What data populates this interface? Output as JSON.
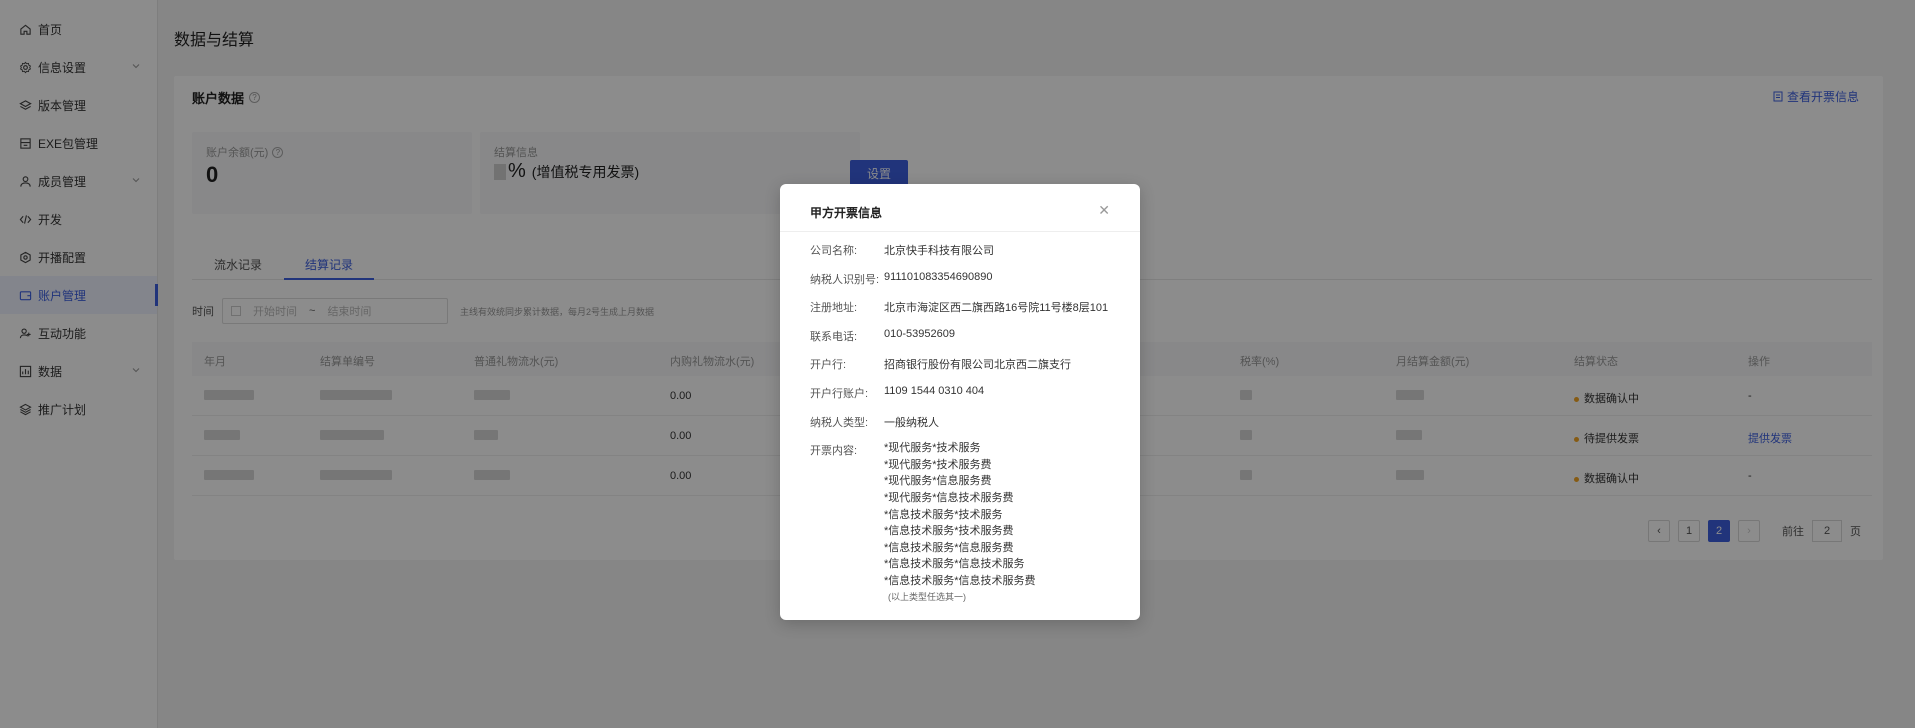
{
  "sidebar": {
    "items": [
      {
        "label": "首页",
        "icon": "home-icon",
        "has_children": false
      },
      {
        "label": "信息设置",
        "icon": "gear-icon",
        "has_children": true
      },
      {
        "label": "版本管理",
        "icon": "layers-icon",
        "has_children": false
      },
      {
        "label": "EXE包管理",
        "icon": "package-icon",
        "has_children": false
      },
      {
        "label": "成员管理",
        "icon": "user-icon",
        "has_children": true
      },
      {
        "label": "开发",
        "icon": "code-icon",
        "has_children": false
      },
      {
        "label": "开播配置",
        "icon": "settings-icon",
        "has_children": false
      },
      {
        "label": "账户管理",
        "icon": "wallet-icon",
        "has_children": false,
        "active": true
      },
      {
        "label": "互动功能",
        "icon": "user-plus-icon",
        "has_children": false
      },
      {
        "label": "数据",
        "icon": "chart-icon",
        "has_children": true
      },
      {
        "label": "推广计划",
        "icon": "stack-icon",
        "has_children": false
      }
    ]
  },
  "page": {
    "title": "数据与结算",
    "card_title": "账户数据",
    "invoice_link": "查看开票信息",
    "balance_label": "账户余额(元)",
    "balance_value": "0",
    "settlement_label": "结算信息",
    "settlement_pct": "%",
    "settlement_note": "(增值税专用发票)",
    "setting_button": "设置",
    "tabs": [
      "流水记录",
      "结算记录"
    ],
    "active_tab": 1,
    "filter": {
      "label": "时间",
      "start_placeholder": "开始时间",
      "separator": "~",
      "end_placeholder": "结束时间",
      "hint": "主线有效统同步累计数据，每月2号生成上月数据"
    },
    "table": {
      "headers": [
        "年月",
        "结算单编号",
        "普通礼物流水(元)",
        "内购礼物流水(元)",
        "税率(%)",
        "月结算金额(元)",
        "结算状态",
        "操作"
      ],
      "rows": [
        {
          "internal": "0.00",
          "status": "数据确认中",
          "action": "-"
        },
        {
          "internal": "0.00",
          "status": "待提供发票",
          "action": "提供发票"
        },
        {
          "internal": "0.00",
          "status": "数据确认中",
          "action": "-"
        }
      ]
    },
    "pager": {
      "pages": [
        "1",
        "2"
      ],
      "current": "2",
      "goto_label": "前往",
      "goto_value": "2",
      "page_unit": "页"
    }
  },
  "modal": {
    "title": "甲方开票信息",
    "fields": [
      {
        "key": "公司名称:",
        "value": "北京快手科技有限公司"
      },
      {
        "key": "纳税人识别号:",
        "value": "911101083354690890"
      },
      {
        "key": "注册地址:",
        "value": "北京市海淀区西二旗西路16号院11号楼8层101"
      },
      {
        "key": "联系电话:",
        "value": "010-53952609"
      },
      {
        "key": "开户行:",
        "value": "招商银行股份有限公司北京西二旗支行"
      },
      {
        "key": "开户行账户:",
        "value": "1109 1544 0310 404"
      },
      {
        "key": "纳税人类型:",
        "value": "一般纳税人"
      }
    ],
    "content_key": "开票内容:",
    "content_items": [
      "*现代服务*技术服务",
      "*现代服务*技术服务费",
      "*现代服务*信息服务费",
      "*现代服务*信息技术服务费",
      "*信息技术服务*技术服务",
      "*信息技术服务*技术服务费",
      "*信息技术服务*信息服务费",
      "*信息技术服务*信息技术服务",
      "*信息技术服务*信息技术服务费"
    ],
    "content_note": "(以上类型任选其一)"
  },
  "colors": {
    "primary": "#3c5fe0",
    "status_warning": "#f5a623"
  }
}
